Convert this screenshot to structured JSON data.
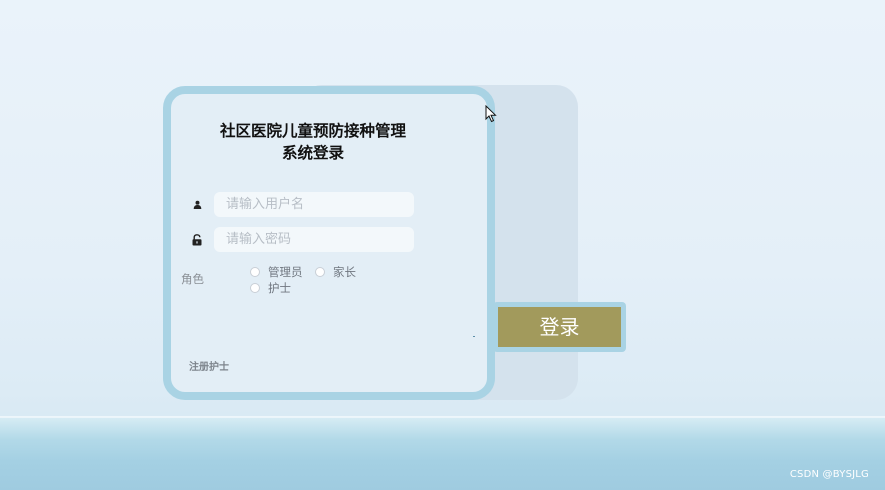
{
  "login": {
    "title_line1": "社区医院儿童预防接种管理",
    "title_line2": "系统登录",
    "username_placeholder": "请输入用户名",
    "password_placeholder": "请输入密码",
    "role_label": "角色",
    "roles": [
      "管理员",
      "家长",
      "护士"
    ],
    "register_label": "注册护士",
    "login_button_label": "登录"
  },
  "icons": {
    "username": "user-icon",
    "password": "lock-icon",
    "cursor": "mouse-pointer-icon"
  },
  "colors": {
    "card_border": "#a9d3e4",
    "card_background": "#e3eef6",
    "login_button": "#a29a5c"
  },
  "watermark": "CSDN @BYSJLG"
}
